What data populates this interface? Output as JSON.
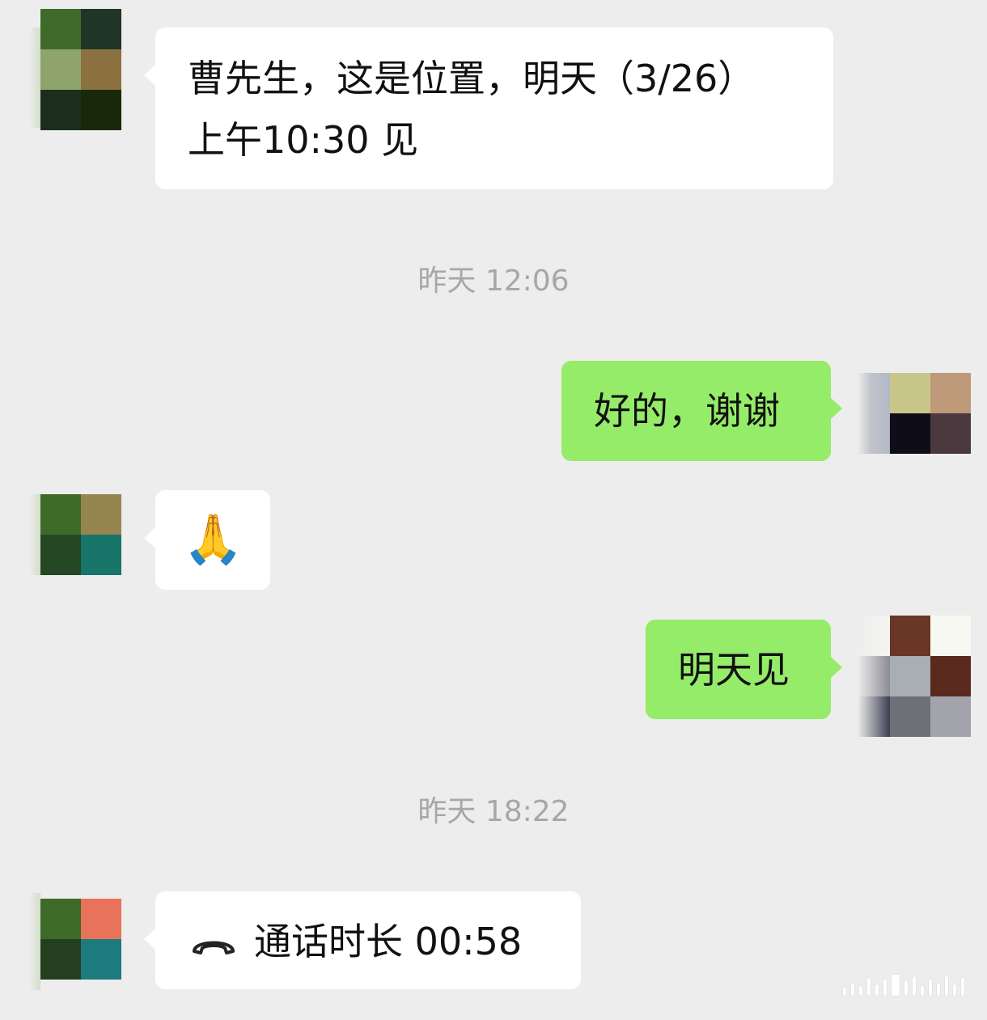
{
  "messages": [
    {
      "side": "in",
      "text": "曹先生，这是位置，明天（3/26）\n上午10:30 见"
    },
    {
      "timestamp": "昨天 12:06"
    },
    {
      "side": "out",
      "text": "好的，谢谢"
    },
    {
      "side": "in",
      "emoji": "🙏"
    },
    {
      "side": "out",
      "text": "明天见"
    },
    {
      "timestamp": "昨天 18:22"
    },
    {
      "side": "in",
      "call_label": "通话时长 00:58",
      "icon": "phone-hangup-icon"
    }
  ],
  "colors": {
    "background": "#ededed",
    "incoming_bubble": "#ffffff",
    "outgoing_bubble": "#95ec69",
    "timestamp_text": "#a7a7a7"
  }
}
